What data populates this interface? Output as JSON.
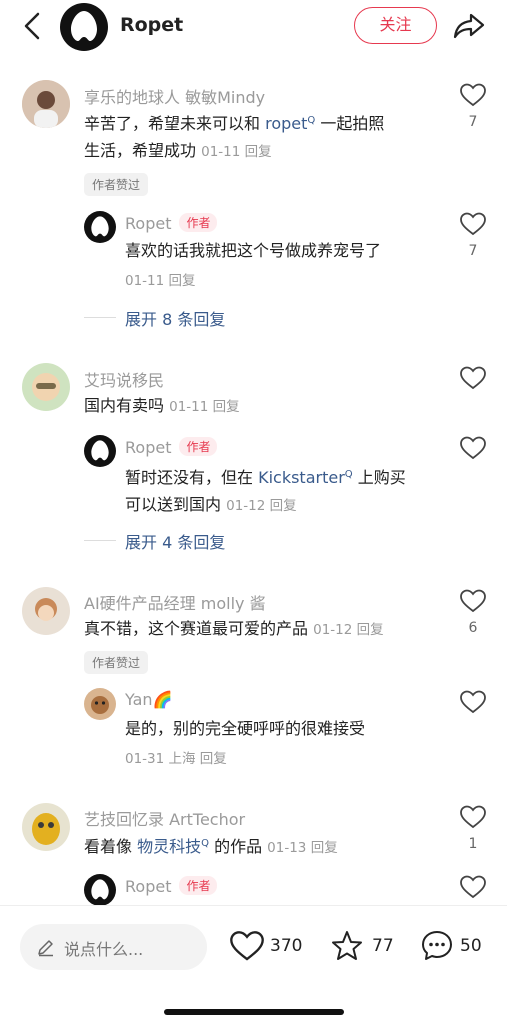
{
  "header": {
    "name": "Ropet",
    "follow_label": "关注"
  },
  "comments": [
    {
      "user": "享乐的地球人 敏敏Mindy",
      "text_line1_pre": "辛苦了，希望未来可以和 ",
      "text_line1_link": "ropet",
      "text_line1_post": " 一起拍照",
      "text_line2": "生活，希望成功",
      "meta": "01-11 回复",
      "likes": "7",
      "badge": "作者赞过",
      "reply": {
        "user": "Ropet",
        "tag": "作者",
        "text": "喜欢的话我就把这个号做成养宠号了",
        "meta": "01-11 回复",
        "likes": "7"
      },
      "expand": "展开 8 条回复"
    },
    {
      "user": "艾玛说移民",
      "text": "国内有卖吗",
      "meta": "01-11 回复",
      "reply": {
        "user": "Ropet",
        "tag": "作者",
        "text_pre": "暂时还没有，但在 ",
        "text_link": "Kickstarter",
        "text_post": " 上购买",
        "text_line2": "可以送到国内",
        "meta": "01-12 回复"
      },
      "expand": "展开 4 条回复"
    },
    {
      "user": "AI硬件产品经理 molly 酱",
      "text": "真不错，这个赛道最可爱的产品",
      "meta": "01-12 回复",
      "likes": "6",
      "badge": "作者赞过",
      "reply": {
        "user": "Yan🌈",
        "text": "是的，别的完全硬呼呼的很难接受",
        "meta": "01-31 上海 回复"
      }
    },
    {
      "user": "艺技回忆录 ArtTechor",
      "text_pre": "看着像 ",
      "text_link": "物灵科技",
      "text_post": " 的作品",
      "meta": "01-13 回复",
      "likes": "1",
      "reply": {
        "user": "Ropet",
        "tag": "作者"
      }
    }
  ],
  "bottom": {
    "placeholder": "说点什么...",
    "likes": "370",
    "stars": "77",
    "comments": "50"
  },
  "colors": {
    "accent": "#e6394f",
    "link": "#3a5b8c"
  }
}
